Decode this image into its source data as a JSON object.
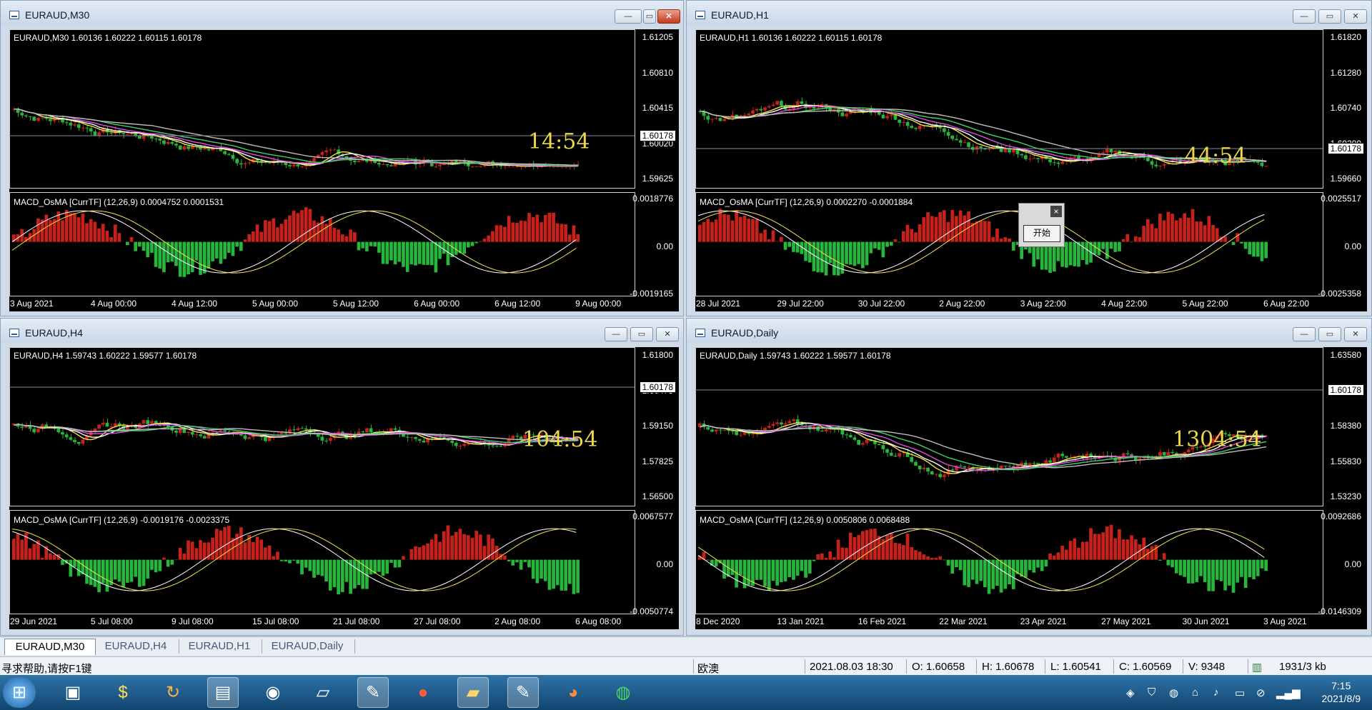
{
  "windows": [
    {
      "title": "EURAUD,M30",
      "header": "EURAUD,M30  1.60136 1.60222 1.60115 1.60178",
      "timer": "14:54",
      "indicator": "MACD_OsMA [CurrTF] (12,26,9) 0.0004752 0.0001531",
      "price_labels": [
        "1.61205",
        "1.60810",
        "1.60415",
        "1.60020",
        "1.59625"
      ],
      "macd_labels": [
        "0.0018776",
        "0.00",
        "-0.0019165"
      ],
      "x_labels": [
        "3 Aug 2021",
        "4 Aug 00:00",
        "4 Aug 12:00",
        "5 Aug 00:00",
        "5 Aug 12:00",
        "6 Aug 00:00",
        "6 Aug 12:00",
        "9 Aug 00:00"
      ],
      "current_price": "1.60178"
    },
    {
      "title": "EURAUD,H1",
      "header": "EURAUD,H1  1.60136 1.60222 1.60115 1.60178",
      "timer": "44:54",
      "indicator": "MACD_OsMA [CurrTF] (12,26,9) 0.0002270 -0.0001884",
      "price_labels": [
        "1.61820",
        "1.61280",
        "1.60740",
        "1.60200",
        "1.59660"
      ],
      "macd_labels": [
        "0.0025517",
        "0.00",
        "-0.0025358"
      ],
      "x_labels": [
        "28 Jul 2021",
        "29 Jul 22:00",
        "30 Jul 22:00",
        "2 Aug 22:00",
        "3 Aug 22:00",
        "4 Aug 22:00",
        "5 Aug 22:00",
        "6 Aug 22:00"
      ],
      "current_price": "1.60178"
    },
    {
      "title": "EURAUD,H4",
      "header": "EURAUD,H4  1.59743 1.60222 1.59577 1.60178",
      "timer": "104:54",
      "indicator": "MACD_OsMA [CurrTF] (12,26,9) -0.0019176 -0.0023375",
      "price_labels": [
        "1.61800",
        "1.60475",
        "1.59150",
        "1.57825",
        "1.56500"
      ],
      "macd_labels": [
        "0.0067577",
        "0.00",
        "-0.0050774"
      ],
      "x_labels": [
        "29 Jun 2021",
        "5 Jul 08:00",
        "9 Jul 08:00",
        "15 Jul 08:00",
        "21 Jul 08:00",
        "27 Jul 08:00",
        "2 Aug 08:00",
        "6 Aug 08:00"
      ],
      "current_price": "1.60178"
    },
    {
      "title": "EURAUD,Daily",
      "header": "EURAUD,Daily  1.59743 1.60222 1.59577 1.60178",
      "timer": "1304:54",
      "indicator": "MACD_OsMA [CurrTF] (12,26,9) 0.0050806 0.0068488",
      "price_labels": [
        "1.63580",
        "1.60980",
        "1.58380",
        "1.55830",
        "1.53230"
      ],
      "macd_labels": [
        "0.0092686",
        "0.00",
        "-0.0146309"
      ],
      "x_labels": [
        "8 Dec 2020",
        "13 Jan 2021",
        "16 Feb 2021",
        "22 Mar 2021",
        "23 Apr 2021",
        "27 May 2021",
        "30 Jun 2021",
        "3 Aug 2021"
      ],
      "current_price": "1.60178"
    }
  ],
  "popup": {
    "button_label": "开始",
    "close_label": "×"
  },
  "tabs": [
    "EURAUD,M30",
    "EURAUD,H4",
    "EURAUD,H1",
    "EURAUD,Daily"
  ],
  "status": {
    "help": "寻求帮助,请按F1键",
    "profile": "欧澳",
    "datetime": "2021.08.03 18:30",
    "open": "O: 1.60658",
    "high": "H: 1.60678",
    "low": "L: 1.60541",
    "close": "C: 1.60569",
    "volume": "V: 9348",
    "traffic": "1931/3 kb"
  },
  "clock": {
    "time": "7:15",
    "date": "2021/8/9"
  },
  "taskbar_icons": [
    "windows-start-icon",
    "manager-icon",
    "dollar-icon",
    "refresh-icon",
    "terminal-icon",
    "camera-icon",
    "document-icon",
    "paint-icon",
    "tomato-icon",
    "folder-icon",
    "paint2-icon",
    "ninja-icon",
    "wechat-icon"
  ],
  "colors": {
    "bull": "#28b53b",
    "bear": "#c8211a",
    "ma_yellow": "#f4e34a",
    "ma_magenta": "#e14de0",
    "ma_green": "#41d16b",
    "ma_gray": "#bdbdbd",
    "timer": "#e9d64a"
  }
}
